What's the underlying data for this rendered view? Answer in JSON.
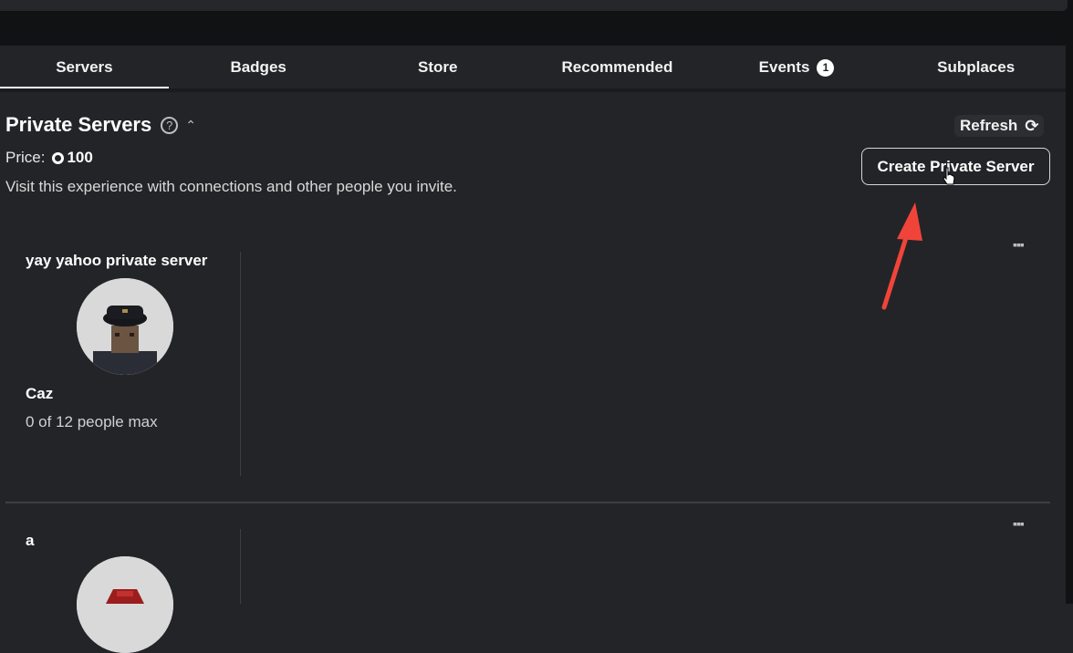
{
  "tabs": [
    {
      "label": "Servers",
      "active": true
    },
    {
      "label": "Badges"
    },
    {
      "label": "Store"
    },
    {
      "label": "Recommended"
    },
    {
      "label": "Events",
      "badge": "1"
    },
    {
      "label": "Subplaces"
    }
  ],
  "private_servers": {
    "title": "Private Servers",
    "price_label": "Price:",
    "price_value": "100",
    "description": "Visit this experience with connections and other people you invite.",
    "refresh_label": "Refresh",
    "create_button": "Create Private Server"
  },
  "servers": [
    {
      "name": "yay yahoo private server",
      "owner": "Caz",
      "capacity": "0 of 12 people max"
    },
    {
      "name": "a"
    }
  ],
  "colors": {
    "accent_arrow": "#f0443a",
    "background": "#232427",
    "text": "#ffffff"
  }
}
